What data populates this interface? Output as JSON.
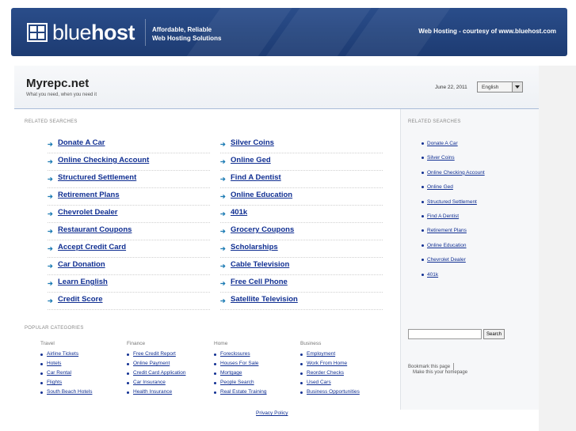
{
  "topbar": {
    "logo_prefix": "blue",
    "logo_suffix": "host",
    "tagline_line1": "Affordable, Reliable",
    "tagline_line2": "Web Hosting Solutions",
    "courtesy": "Web Hosting - courtesy of www.bluehost.com",
    "color": "#1f3f78"
  },
  "header": {
    "title": "Myrepc.net",
    "subtitle": "What you need, when you need it",
    "date": "June 22, 2011",
    "language": "English"
  },
  "related": {
    "label": "RELATED SEARCHES",
    "left": [
      "Donate A Car",
      "Online Checking Account",
      "Structured Settlement",
      "Retirement Plans",
      "Chevrolet Dealer",
      "Restaurant Coupons",
      "Accept Credit Card",
      "Car Donation",
      "Learn English",
      "Credit Score"
    ],
    "right": [
      "Silver Coins",
      "Online Ged",
      "Find A Dentist",
      "Online Education",
      "401k",
      "Grocery Coupons",
      "Scholarships",
      "Cable Television",
      "Free Cell Phone",
      "Satellite Television"
    ]
  },
  "sidebar": {
    "label": "RELATED SEARCHES",
    "items": [
      "Donate A Car",
      "Silver Coins",
      "Online Checking Account",
      "Online Ged",
      "Structured Settlement",
      "Find A Dentist",
      "Retirement Plans",
      "Online Education",
      "Chevrolet Dealer",
      "401k"
    ],
    "search_button": "Search",
    "bookmark": "Bookmark this page",
    "homepage": "Make this your homepage"
  },
  "popular": {
    "label": "POPULAR CATEGORIES",
    "categories": [
      {
        "name": "Travel",
        "items": [
          "Airline Tickets",
          "Hotels",
          "Car Rental",
          "Flights",
          "South Beach Hotels"
        ]
      },
      {
        "name": "Finance",
        "items": [
          "Free Credit Report",
          "Online Payment",
          "Credit Card Application",
          "Car Insurance",
          "Health Insurance"
        ]
      },
      {
        "name": "Home",
        "items": [
          "Foreclosures",
          "Houses For Sale",
          "Mortgage",
          "People Search",
          "Real Estate Training"
        ]
      },
      {
        "name": "Business",
        "items": [
          "Employment",
          "Work From Home",
          "Reorder Checks",
          "Used Cars",
          "Business Opportunities"
        ]
      }
    ]
  },
  "footer": {
    "privacy": "Privacy Policy"
  },
  "colors": {
    "link": "#102f92",
    "arrow": "#1b7ab3"
  }
}
